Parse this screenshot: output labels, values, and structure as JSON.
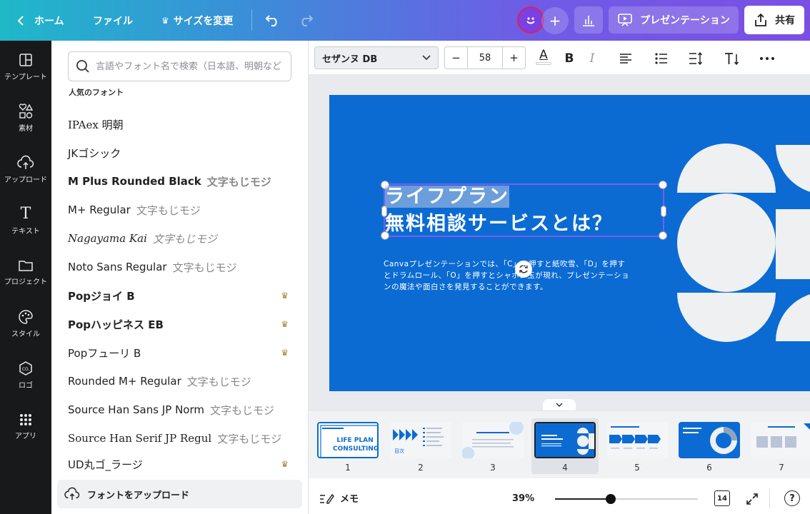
{
  "topbar": {
    "back_label": "ホーム",
    "file_label": "ファイル",
    "resize_label": "サイズを変更",
    "present_label": "プレゼンテーション",
    "share_label": "共有"
  },
  "rail": [
    {
      "label": "テンプレート",
      "icon": "template-icon"
    },
    {
      "label": "素材",
      "icon": "elements-icon"
    },
    {
      "label": "アップロード",
      "icon": "upload-cloud-icon"
    },
    {
      "label": "テキスト",
      "icon": "text-icon"
    },
    {
      "label": "プロジェクト",
      "icon": "folder-icon"
    },
    {
      "label": "スタイル",
      "icon": "palette-icon"
    },
    {
      "label": "ロゴ",
      "icon": "logo-icon"
    },
    {
      "label": "アプリ",
      "icon": "apps-grid-icon"
    }
  ],
  "panel": {
    "search_placeholder": "言語やフォント名で検索（日本語、明朝など）",
    "section_title": "人気のフォント",
    "fonts": [
      {
        "name": "IPAex 明朝",
        "sample": "",
        "pro": false
      },
      {
        "name": "JKゴシック",
        "sample": "",
        "pro": false
      },
      {
        "name": "M Plus Rounded Black",
        "sample": "文字もじモジ",
        "pro": false
      },
      {
        "name": "M+ Regular",
        "sample": "文字もじモジ",
        "pro": false
      },
      {
        "name": "Nagayama Kai",
        "sample": "文字もじモジ",
        "pro": false
      },
      {
        "name": "Noto Sans Regular",
        "sample": "文字もじモジ",
        "pro": false
      },
      {
        "name": "Popジョイ B",
        "sample": "",
        "pro": true
      },
      {
        "name": "Popハッピネス EB",
        "sample": "",
        "pro": true
      },
      {
        "name": "Popフューリ B",
        "sample": "",
        "pro": true
      },
      {
        "name": "Rounded M+ Regular",
        "sample": "文字もじモジ",
        "pro": false
      },
      {
        "name": "Source Han Sans JP Norm",
        "sample": "文字もじモジ",
        "pro": false
      },
      {
        "name": "Source Han Serif JP Regul",
        "sample": "文字もじモジ",
        "pro": false
      },
      {
        "name": "UD丸ゴ_ラージ",
        "sample": "",
        "pro": true
      }
    ],
    "upload_label": "フォントをアップロード"
  },
  "toolbar": {
    "font_family": "セザンヌ DB",
    "font_size": "58",
    "minus": "−",
    "plus": "+",
    "color_letter": "A",
    "bold": "B",
    "italic": "I"
  },
  "slide": {
    "title_line1": "ライフプラン",
    "title_line2": "無料相談サービスとは？",
    "body": "Canvaプレゼンテーションでは、「C」を押すと紙吹雪、「D」を押すとドラムロール、「O」を押すとシャボン玉が現れ、プレゼンテーションの魔法や面白さを発見することができます。"
  },
  "thumbnails": [
    {
      "num": "1",
      "text1": "LIFE PLAN",
      "text2": "CONSULTING"
    },
    {
      "num": "2",
      "text1": "目次"
    },
    {
      "num": "3"
    },
    {
      "num": "4",
      "selected": true
    },
    {
      "num": "5"
    },
    {
      "num": "6"
    },
    {
      "num": "7"
    }
  ],
  "footer": {
    "memo_label": "メモ",
    "zoom": "39%",
    "zoom_fraction": 0.39,
    "page_count": "14",
    "help": "?"
  },
  "colors": {
    "slide_blue": "#0b6bd3",
    "avatar": "#7b3fe4",
    "selection": "#7d5cf0"
  }
}
